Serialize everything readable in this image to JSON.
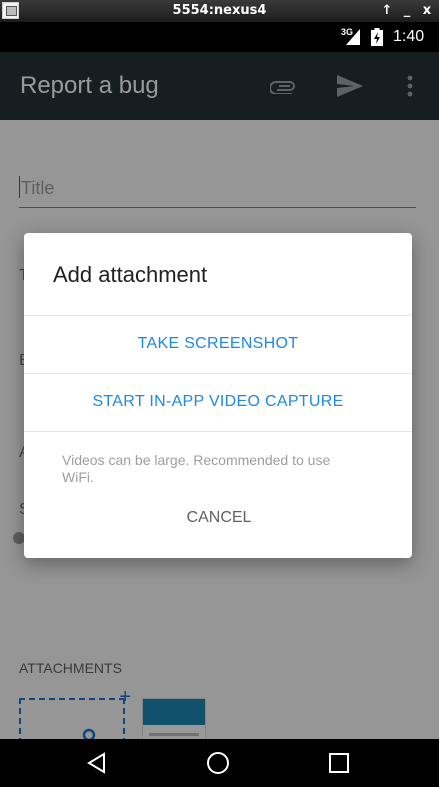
{
  "window": {
    "title": "5554:nexus4",
    "controls": [
      "↑",
      "_",
      "x"
    ]
  },
  "status_bar": {
    "network": "3G",
    "time": "1:40"
  },
  "toolbar": {
    "title": "Report a bug",
    "icons": [
      "paperclip-icon",
      "send-icon",
      "overflow-menu-icon"
    ]
  },
  "form": {
    "title_placeholder": "Title",
    "peek_letters": [
      "T",
      "B",
      "A",
      "S"
    ],
    "attachments_label": "ATTACHMENTS"
  },
  "dialog": {
    "title": "Add attachment",
    "options": [
      "TAKE SCREENSHOT",
      "START IN-APP VIDEO CAPTURE"
    ],
    "note": "Videos can be large. Recommended to use WiFi.",
    "cancel": "CANCEL"
  },
  "colors": {
    "toolbar": "#263238",
    "accent": "#1e88e5"
  }
}
